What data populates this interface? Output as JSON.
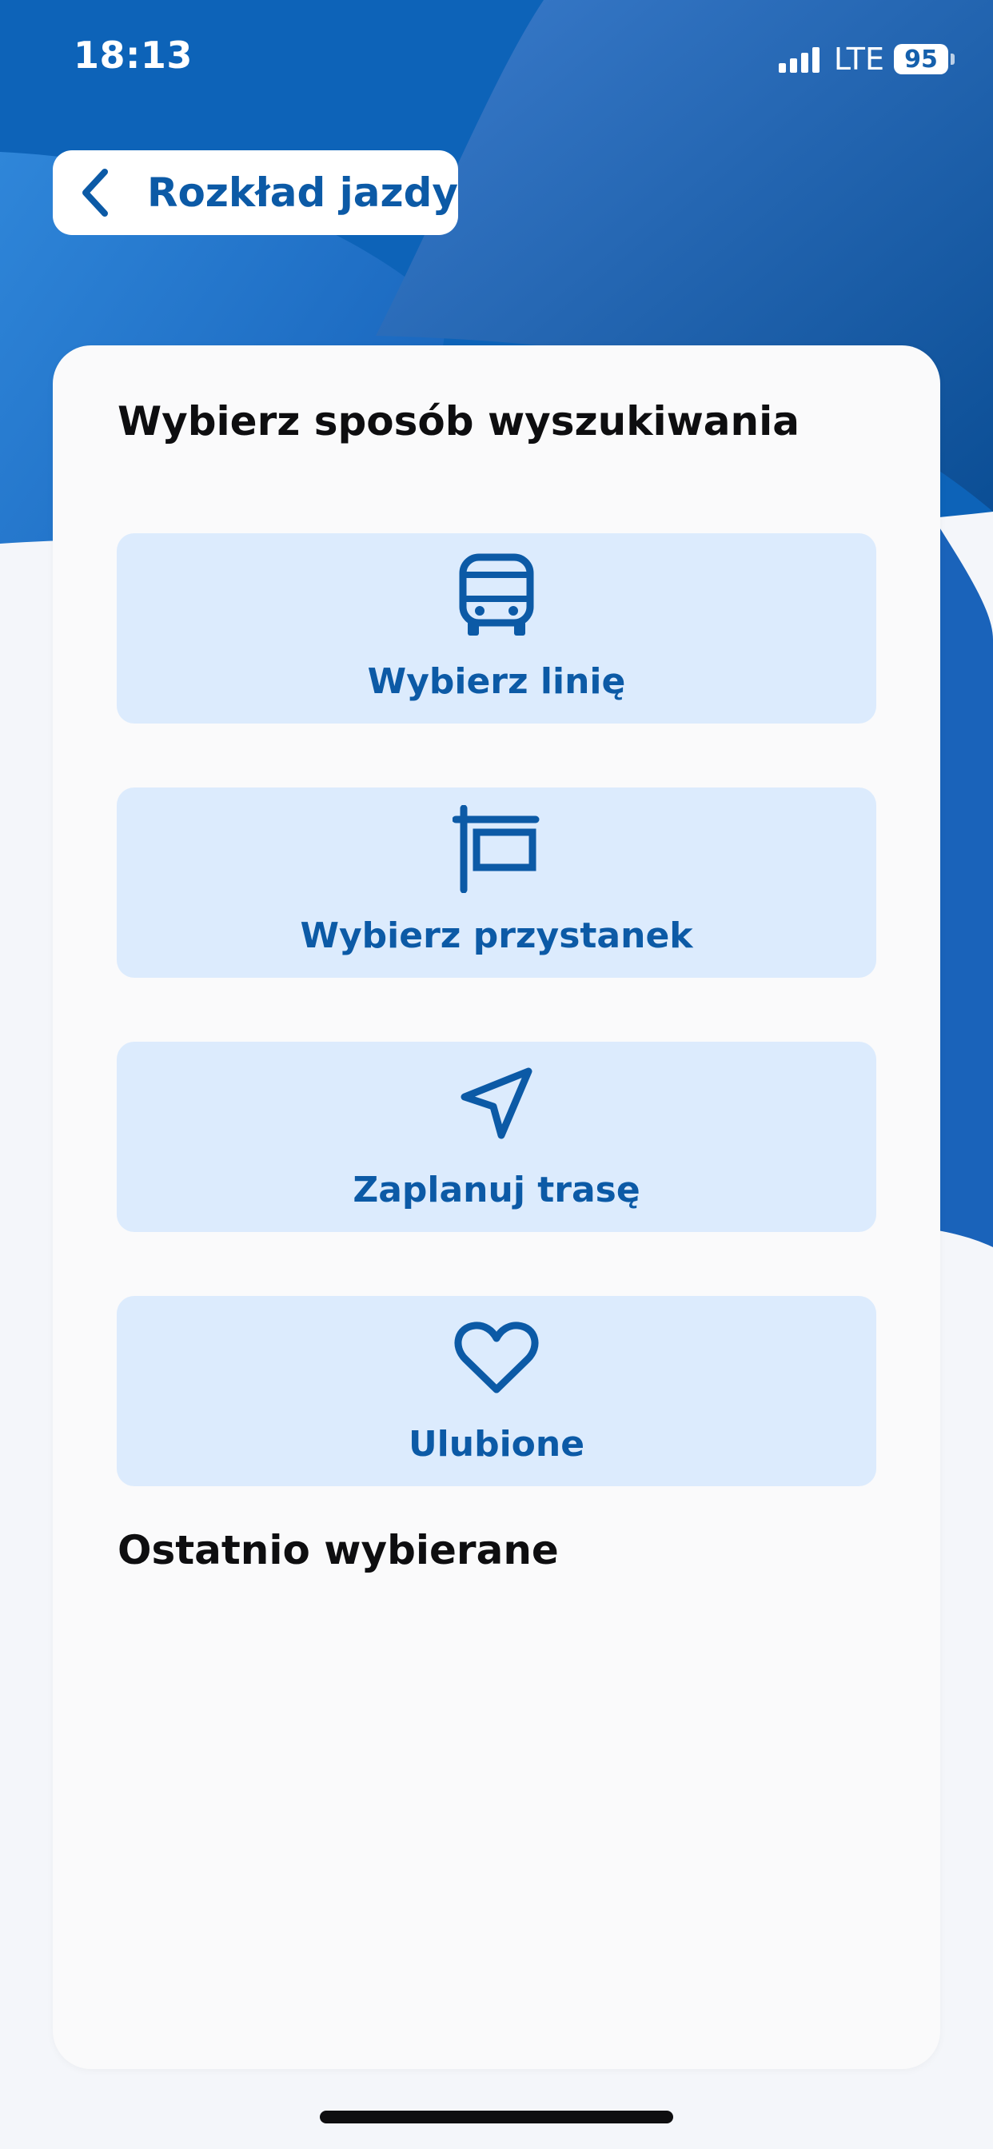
{
  "status_bar": {
    "time": "18:13",
    "network": "LTE",
    "battery": "95"
  },
  "header": {
    "title": "Rozkład jazdy",
    "back_icon": "chevron-left-icon"
  },
  "card": {
    "heading": "Wybierz sposób wyszukiwania",
    "options": [
      {
        "label": "Wybierz linię",
        "icon": "bus-icon"
      },
      {
        "label": "Wybierz przystanek",
        "icon": "bus-stop-icon"
      },
      {
        "label": "Zaplanuj trasę",
        "icon": "navigation-arrow-icon"
      },
      {
        "label": "Ulubione",
        "icon": "heart-icon"
      }
    ],
    "recent_heading": "Ostatnio wybierane"
  },
  "colors": {
    "brand_blue": "#0C5AA6",
    "option_background": "#DCEBFD",
    "card_background": "#FAFAFB"
  }
}
